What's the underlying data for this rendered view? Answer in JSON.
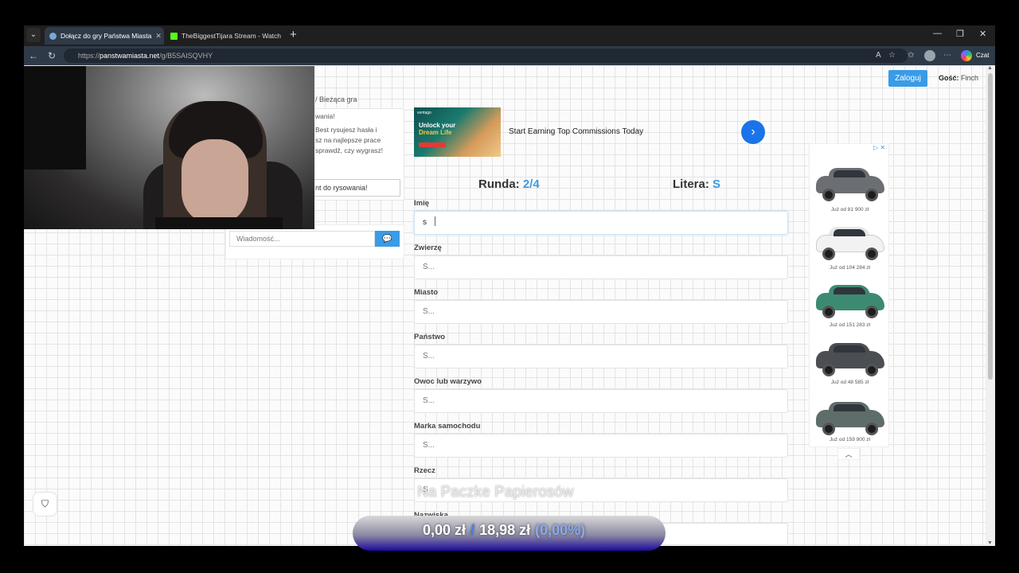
{
  "browser": {
    "tabs": [
      {
        "title": "Dołącz do gry Państwa Miasta",
        "active": true
      },
      {
        "title": "TheBiggestTijara Stream - Watch L",
        "active": false
      }
    ],
    "url_prefix": "https://",
    "url_host": "panstwamiasta.net",
    "url_path": "/g/B5SAISQVHY",
    "copilot_label": "Czat"
  },
  "header": {
    "login_label": "Zaloguj",
    "guest_prefix": "Gość:",
    "guest_name": "Finch"
  },
  "left_panel": {
    "breadcrumb": "/  Bieżąca gra",
    "chat_lines": [
      "wania!",
      "Best rysujesz hasła i",
      "sz na najlepsze prace",
      "sprawdź, czy wygrasz!"
    ],
    "draw_button": "nt do rysowania!",
    "message_placeholder": "Wiadomość..."
  },
  "top_ad": {
    "brand": "ventago",
    "headline": "Unlock your",
    "headline2": "Dream Life",
    "text": "Start Earning Top Commissions Today"
  },
  "game": {
    "round_label": "Runda:",
    "round_value": "2/4",
    "letter_label": "Litera:",
    "letter_value": "S",
    "fields": [
      {
        "label": "Imię",
        "value": "s",
        "placeholder": "S..."
      },
      {
        "label": "Zwierzę",
        "value": "",
        "placeholder": "S..."
      },
      {
        "label": "Miasto",
        "value": "",
        "placeholder": "S..."
      },
      {
        "label": "Państwo",
        "value": "",
        "placeholder": "S..."
      },
      {
        "label": "Owoc lub warzywo",
        "value": "",
        "placeholder": "S..."
      },
      {
        "label": "Marka samochodu",
        "value": "",
        "placeholder": "S..."
      },
      {
        "label": "Rzecz",
        "value": "",
        "placeholder": "S"
      },
      {
        "label": "Nazwiska",
        "value": "",
        "placeholder": ""
      }
    ]
  },
  "right_ad": {
    "prices": [
      "Już od 81 900 zł",
      "Już od 104 284 zł",
      "Już od 151 283 zł",
      "Już od 48 585 zł",
      "Już od 159 900 zł"
    ],
    "colors": [
      "#6b6e72",
      "#f2f2f2",
      "#3d8a72",
      "#4b4e52",
      "#5f6d6a"
    ]
  },
  "overlay": {
    "title": "Na Paczke Papierosów",
    "current": "0,00 zł",
    "goal": "18,98 zł",
    "percent": "(0,00%)",
    "progress_fraction": 0.0
  }
}
